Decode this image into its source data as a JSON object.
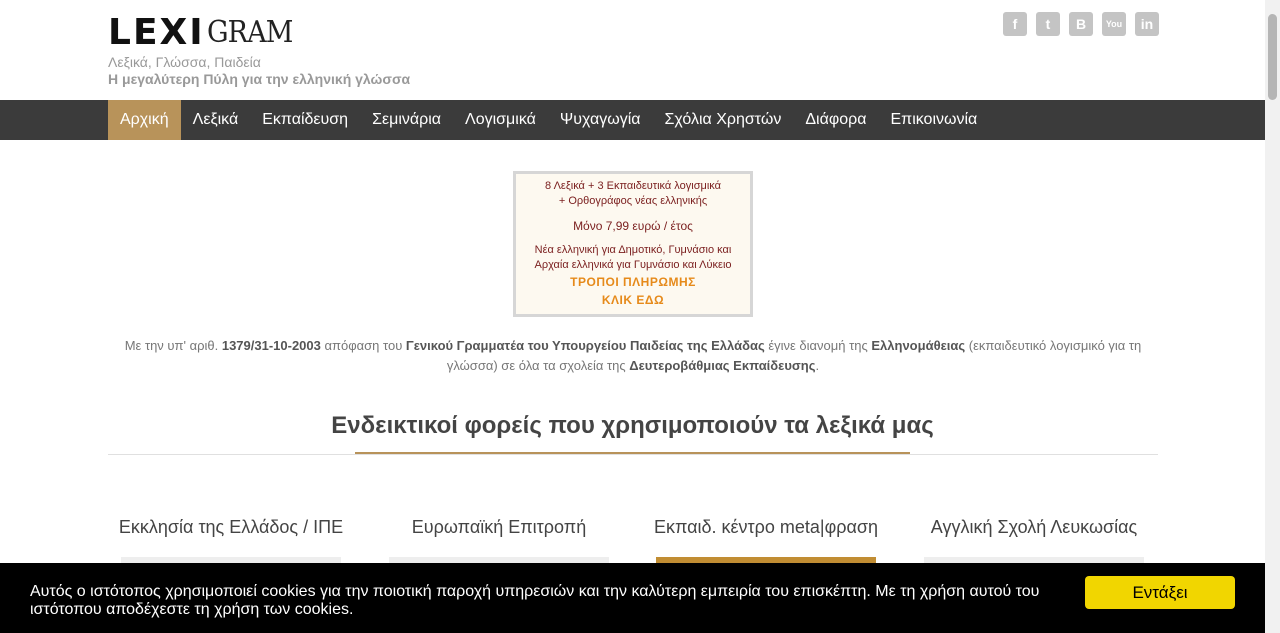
{
  "header": {
    "logo_bold": "LEXI",
    "logo_thin": "GRAM",
    "tagline1": "Λεξικά, Γλώσσα, Παιδεία",
    "tagline2": "Η μεγαλύτερη Πύλη για την ελληνική γλώσσα"
  },
  "social": {
    "facebook": "f",
    "twitter": "t",
    "blogger": "B",
    "youtube": "You",
    "linkedin": "in"
  },
  "nav": {
    "items": [
      {
        "label": "Αρχική"
      },
      {
        "label": "Λεξικά"
      },
      {
        "label": "Εκπαίδευση"
      },
      {
        "label": "Σεμινάρια"
      },
      {
        "label": "Λογισμικά"
      },
      {
        "label": "Ψυχαγωγία"
      },
      {
        "label": "Σχόλια Χρηστών"
      },
      {
        "label": "Διάφορα"
      },
      {
        "label": "Επικοινωνία"
      }
    ]
  },
  "banner": {
    "line1": "8 Λεξικά + 3 Εκπαιδευτικά λογισμικά",
    "line2": "+ Ορθογράφος νέας ελληνικής",
    "price": "Μόνο 7,99 ευρώ / έτος",
    "line3": "Νέα ελληνική για Δημοτικό, Γυμνάσιο και",
    "line4": "Αρχαία ελληνικά για Γυμνάσιο και Λύκειο",
    "payment": "ΤΡΟΠΟΙ ΠΛΗΡΩΜΗΣ",
    "click": "ΚΛΙΚ ΕΔΩ"
  },
  "decision": {
    "t1": "Με την υπ' αριθ. ",
    "number": "1379/31-10-2003",
    "t2": " απόφαση του ",
    "authority": "Γενικού Γραμματέα του Υπουργείου Παιδείας της Ελλάδας",
    "t3": " έγινε διανομή της ",
    "product": "Ελληνομάθειας",
    "t4": " (εκπαιδευτικό λογισμικό για τη γλώσσα) σε όλα τα σχολεία της ",
    "level": "Δευτεροβάθμιας Εκπαίδευσης",
    "t5": "."
  },
  "section": {
    "title": "Ενδεικτικοί φορείς που χρησιμοποιούν τα λεξικά μας"
  },
  "orgs": [
    {
      "name": "Εκκλησία της Ελλάδος / ΙΠΕ"
    },
    {
      "name": "Ευρωπαϊκή Επιτροπή"
    },
    {
      "name": "Εκπαιδ. κέντρο meta|φραση"
    },
    {
      "name": "Αγγλική Σχολή Λευκωσίας"
    }
  ],
  "cookie": {
    "text": "Αυτός ο ιστότοπος χρησιμοποιεί cookies για την ποιοτική παροχή υπηρεσιών και την καλύτερη εμπειρία του επισκέπτη. Με τη χρήση αυτού του ιστότοπου αποδέχεστε τη χρήση των cookies.",
    "button": "Εντάξει"
  },
  "colors": {
    "nav_bg": "#3b3b3b",
    "accent": "#b8935a",
    "cookie_button": "#f1d600"
  }
}
